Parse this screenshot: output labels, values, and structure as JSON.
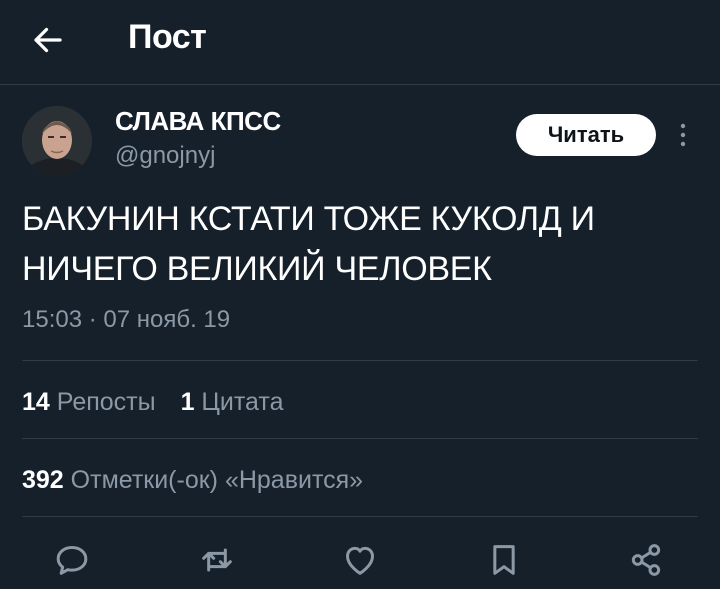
{
  "header": {
    "title": "Пост"
  },
  "author": {
    "name": "СЛАВА КПСС",
    "handle": "@gnojnyj",
    "follow_label": "Читать"
  },
  "tweet": {
    "text_line1": "БАКУНИН КСТАТИ ТОЖЕ КУКОЛД И",
    "text_line2": "НИЧЕГО ВЕЛИКИЙ ЧЕЛОВЕК",
    "timestamp": "15:03 · 07 нояб. 19"
  },
  "stats": {
    "reposts_count": "14",
    "reposts_label": "Репосты",
    "quotes_count": "1",
    "quotes_label": "Цитата",
    "likes_count": "392",
    "likes_label": "Отметки(-ок) «Нравится»"
  },
  "icons": {
    "back": "arrow-left-icon",
    "more": "more-vertical-icon",
    "reply": "reply-icon",
    "retweet": "retweet-icon",
    "like": "heart-icon",
    "bookmark": "bookmark-icon",
    "share": "share-icon"
  },
  "colors": {
    "background": "#15202b",
    "secondary_text": "#8b98a5",
    "divider": "#2f3b47"
  }
}
